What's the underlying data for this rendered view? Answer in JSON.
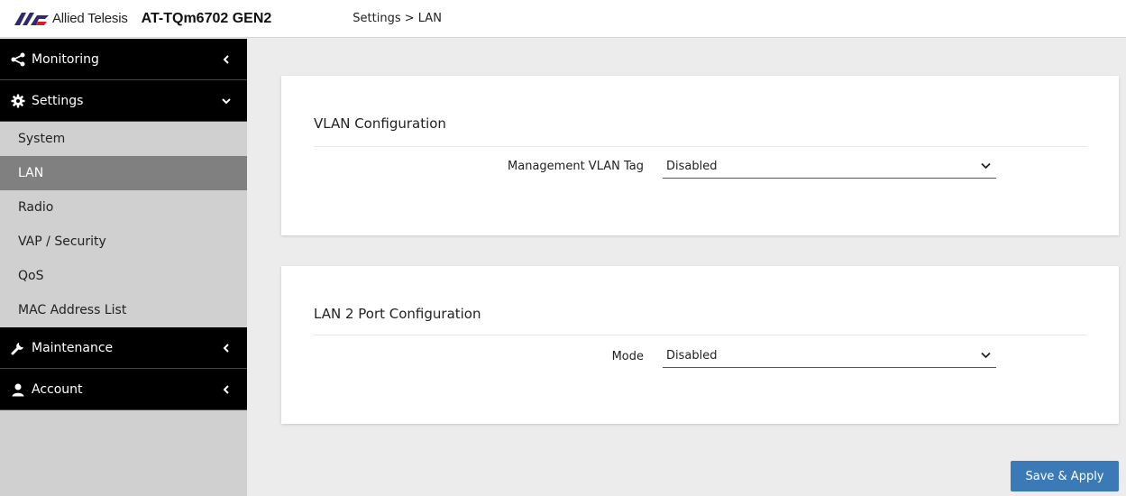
{
  "header": {
    "brand": "Allied Telesis",
    "model": "AT-TQm6702 GEN2",
    "breadcrumb": "Settings > LAN"
  },
  "sidebar": {
    "sections": [
      {
        "label": "Monitoring",
        "icon": "share-icon",
        "expanded": false
      },
      {
        "label": "Settings",
        "icon": "gear-icon",
        "expanded": true
      },
      {
        "label": "Maintenance",
        "icon": "wrench-icon",
        "expanded": false
      },
      {
        "label": "Account",
        "icon": "user-icon",
        "expanded": false
      }
    ],
    "settings_items": [
      {
        "label": "System"
      },
      {
        "label": "LAN",
        "active": true
      },
      {
        "label": "Radio"
      },
      {
        "label": "VAP / Security"
      },
      {
        "label": "QoS"
      },
      {
        "label": "MAC Address List"
      }
    ]
  },
  "vlan_card": {
    "title": "VLAN Configuration",
    "field_label": "Management VLAN Tag",
    "value": "Disabled"
  },
  "lan2_card": {
    "title": "LAN 2 Port Configuration",
    "field_label": "Mode",
    "value": "Disabled"
  },
  "actions": {
    "save_label": "Save & Apply"
  },
  "colors": {
    "brand_purple": "#2e2a6b",
    "brand_red": "#d21f26",
    "nav_bg": "#000000",
    "active_item_bg": "#808080",
    "button_blue": "#3b7ab7"
  }
}
